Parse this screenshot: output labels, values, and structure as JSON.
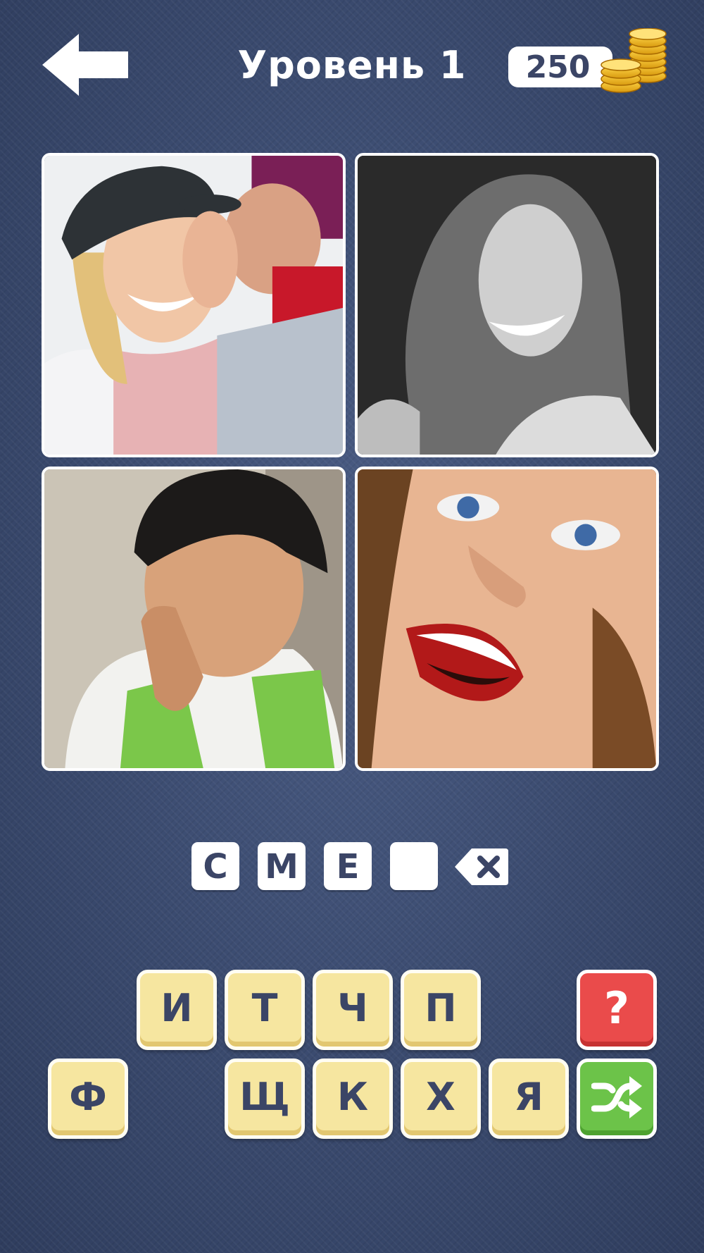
{
  "header": {
    "title": "Уровень 1",
    "coins": "250",
    "back_icon": "arrow-left-icon",
    "coins_icon": "coin-stack-icon"
  },
  "photos": [
    {
      "name": "photo-couple-whisper"
    },
    {
      "name": "photo-woman-laughing-bw"
    },
    {
      "name": "photo-boy-laughing"
    },
    {
      "name": "photo-woman-smiling-closeup"
    }
  ],
  "answer": {
    "slots": [
      "С",
      "М",
      "Е",
      ""
    ],
    "delete_icon": "backspace-icon"
  },
  "letters": {
    "row1": [
      "И",
      "Т",
      "Ч",
      "П"
    ],
    "row2": [
      "Ф",
      "Щ",
      "К",
      "Х",
      "Я"
    ]
  },
  "actions": {
    "hint_label": "?",
    "hint_color": "#ea4b4b",
    "shuffle_icon": "shuffle-icon",
    "shuffle_color": "#6cc349"
  },
  "colors": {
    "background": "#3b4c71",
    "tile": "#f6e6a0",
    "text_dark": "#3b4566"
  }
}
